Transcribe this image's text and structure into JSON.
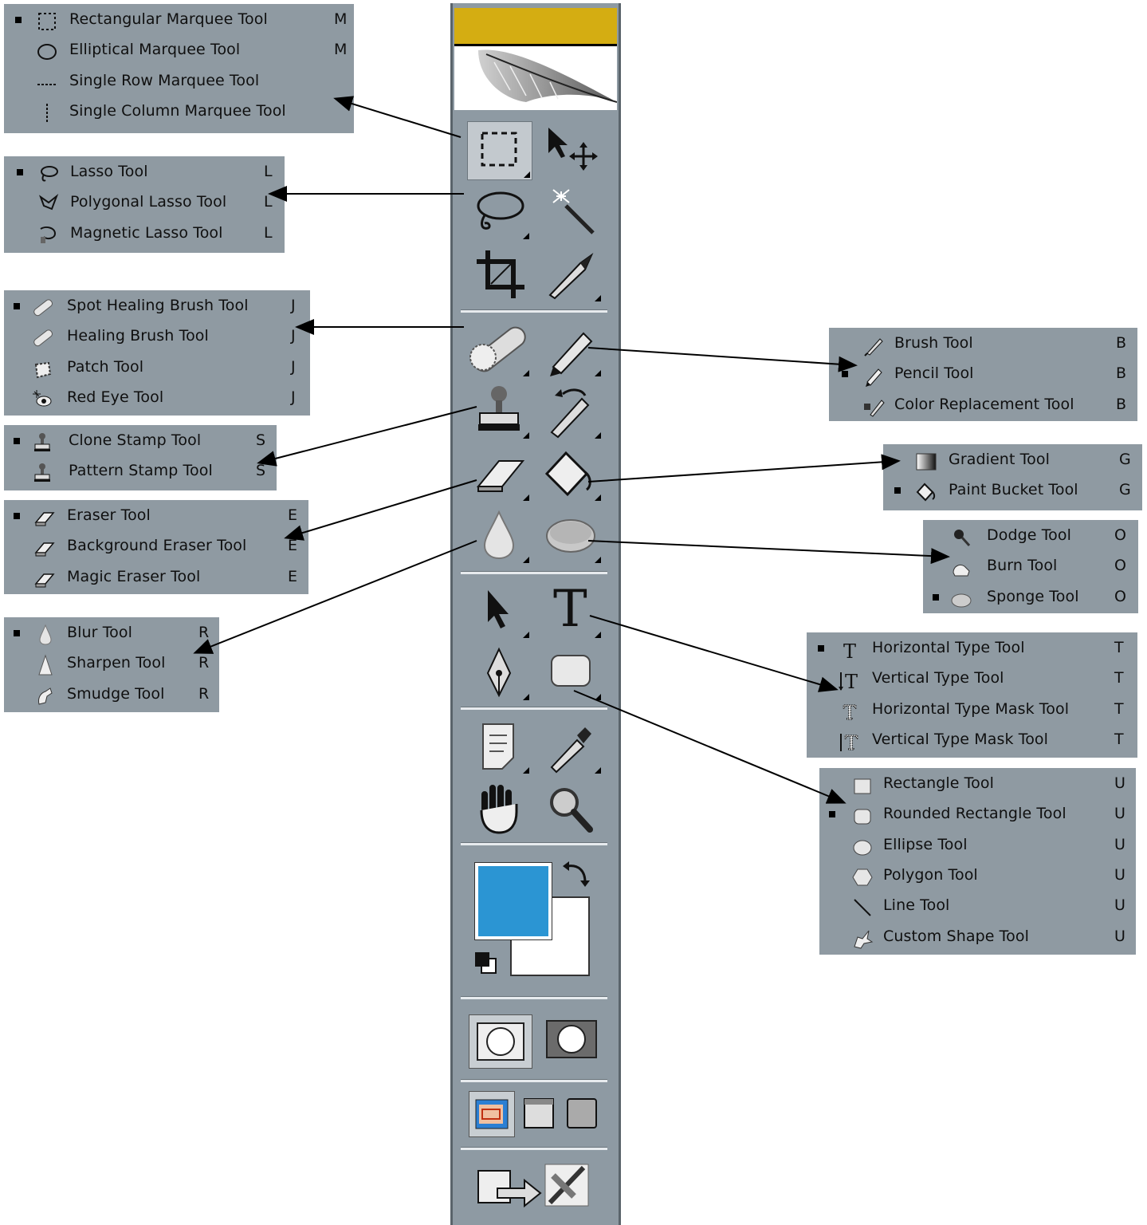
{
  "menus": {
    "marquee": [
      {
        "label": "Rectangular Marquee Tool",
        "key": "M",
        "icon": "rect-marquee-icon",
        "selected": true
      },
      {
        "label": "Elliptical Marquee Tool",
        "key": "M",
        "icon": "ellipse-marquee-icon",
        "selected": false
      },
      {
        "label": "Single Row Marquee Tool",
        "key": "",
        "icon": "single-row-icon",
        "selected": false
      },
      {
        "label": "Single Column Marquee Tool",
        "key": "",
        "icon": "single-column-icon",
        "selected": false
      }
    ],
    "lasso": [
      {
        "label": "Lasso Tool",
        "key": "L",
        "icon": "lasso-icon",
        "selected": true
      },
      {
        "label": "Polygonal Lasso Tool",
        "key": "L",
        "icon": "polygonal-lasso-icon",
        "selected": false
      },
      {
        "label": "Magnetic Lasso Tool",
        "key": "L",
        "icon": "magnetic-lasso-icon",
        "selected": false
      }
    ],
    "healing": [
      {
        "label": "Spot Healing Brush Tool",
        "key": "J",
        "icon": "spot-healing-icon",
        "selected": true
      },
      {
        "label": "Healing Brush Tool",
        "key": "J",
        "icon": "healing-brush-icon",
        "selected": false
      },
      {
        "label": "Patch Tool",
        "key": "J",
        "icon": "patch-icon",
        "selected": false
      },
      {
        "label": "Red Eye Tool",
        "key": "J",
        "icon": "red-eye-icon",
        "selected": false
      }
    ],
    "stamp": [
      {
        "label": "Clone Stamp Tool",
        "key": "S",
        "icon": "clone-stamp-icon",
        "selected": true
      },
      {
        "label": "Pattern Stamp Tool",
        "key": "S",
        "icon": "pattern-stamp-icon",
        "selected": false
      }
    ],
    "eraser": [
      {
        "label": "Eraser Tool",
        "key": "E",
        "icon": "eraser-icon",
        "selected": true
      },
      {
        "label": "Background Eraser Tool",
        "key": "E",
        "icon": "background-eraser-icon",
        "selected": false
      },
      {
        "label": "Magic Eraser Tool",
        "key": "E",
        "icon": "magic-eraser-icon",
        "selected": false
      }
    ],
    "blur": [
      {
        "label": "Blur Tool",
        "key": "R",
        "icon": "blur-icon",
        "selected": true
      },
      {
        "label": "Sharpen Tool",
        "key": "R",
        "icon": "sharpen-icon",
        "selected": false
      },
      {
        "label": "Smudge Tool",
        "key": "R",
        "icon": "smudge-icon",
        "selected": false
      }
    ],
    "brush": [
      {
        "label": "Brush Tool",
        "key": "B",
        "icon": "brush-icon",
        "selected": false
      },
      {
        "label": "Pencil Tool",
        "key": "B",
        "icon": "pencil-icon",
        "selected": true
      },
      {
        "label": "Color Replacement Tool",
        "key": "B",
        "icon": "color-replacement-icon",
        "selected": false
      }
    ],
    "gradient": [
      {
        "label": "Gradient Tool",
        "key": "G",
        "icon": "gradient-icon",
        "selected": false
      },
      {
        "label": "Paint Bucket Tool",
        "key": "G",
        "icon": "paint-bucket-icon",
        "selected": true
      }
    ],
    "dodge": [
      {
        "label": "Dodge Tool",
        "key": "O",
        "icon": "dodge-icon",
        "selected": false
      },
      {
        "label": "Burn Tool",
        "key": "O",
        "icon": "burn-icon",
        "selected": false
      },
      {
        "label": "Sponge Tool",
        "key": "O",
        "icon": "sponge-icon",
        "selected": true
      }
    ],
    "type": [
      {
        "label": "Horizontal Type Tool",
        "key": "T",
        "icon": "horizontal-type-icon",
        "selected": true
      },
      {
        "label": "Vertical Type Tool",
        "key": "T",
        "icon": "vertical-type-icon",
        "selected": false
      },
      {
        "label": "Horizontal Type Mask Tool",
        "key": "T",
        "icon": "horizontal-type-mask-icon",
        "selected": false
      },
      {
        "label": "Vertical Type Mask Tool",
        "key": "T",
        "icon": "vertical-type-mask-icon",
        "selected": false
      }
    ],
    "shape": [
      {
        "label": "Rectangle Tool",
        "key": "U",
        "icon": "rectangle-shape-icon",
        "selected": false
      },
      {
        "label": "Rounded Rectangle Tool",
        "key": "U",
        "icon": "rounded-rectangle-icon",
        "selected": true
      },
      {
        "label": "Ellipse Tool",
        "key": "U",
        "icon": "ellipse-shape-icon",
        "selected": false
      },
      {
        "label": "Polygon Tool",
        "key": "U",
        "icon": "polygon-shape-icon",
        "selected": false
      },
      {
        "label": "Line Tool",
        "key": "U",
        "icon": "line-shape-icon",
        "selected": false
      },
      {
        "label": "Custom Shape Tool",
        "key": "U",
        "icon": "custom-shape-icon",
        "selected": false
      }
    ]
  },
  "toolbar": {
    "header_color": "#d4ad12",
    "type_glyph": "T",
    "foreground_color": "#2b95d3",
    "background_color": "#ffffff"
  },
  "colors": {
    "panel": "#8f9aa2",
    "toolbar": "#8e9aa3",
    "arrow": "#000000"
  }
}
